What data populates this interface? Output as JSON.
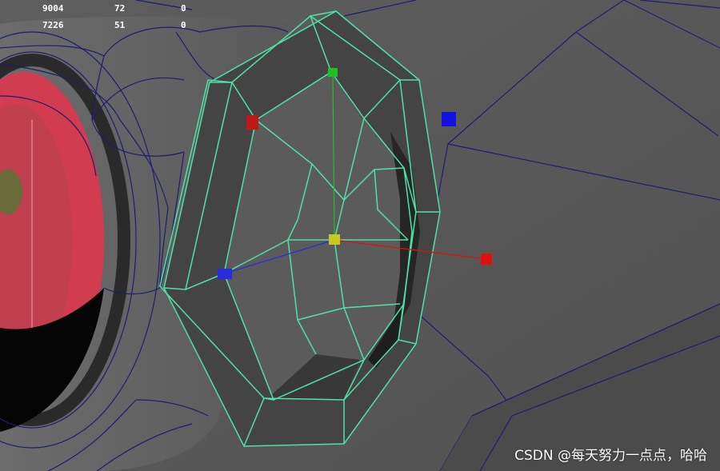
{
  "hud": {
    "rows": [
      [
        "9004",
        "72",
        "0"
      ],
      [
        "7226",
        "51",
        "0"
      ]
    ]
  },
  "watermark": "CSDN @每天努力一点点，哈哈",
  "colors": {
    "background": "#5b5b5b",
    "wireframe": "#1d1d6e",
    "selection": "#4fe2a6",
    "axis_x": "#e01010",
    "axis_y": "#20c020",
    "axis_z": "#2a2ae0",
    "pivot": "#c8c820"
  },
  "icons": {
    "manip_x": "red-axis-handle-icon",
    "manip_y": "green-axis-handle-icon",
    "manip_z": "blue-axis-handle-icon",
    "pivot": "pivot-center-icon",
    "floating_blue": "blue-marker-icon"
  }
}
